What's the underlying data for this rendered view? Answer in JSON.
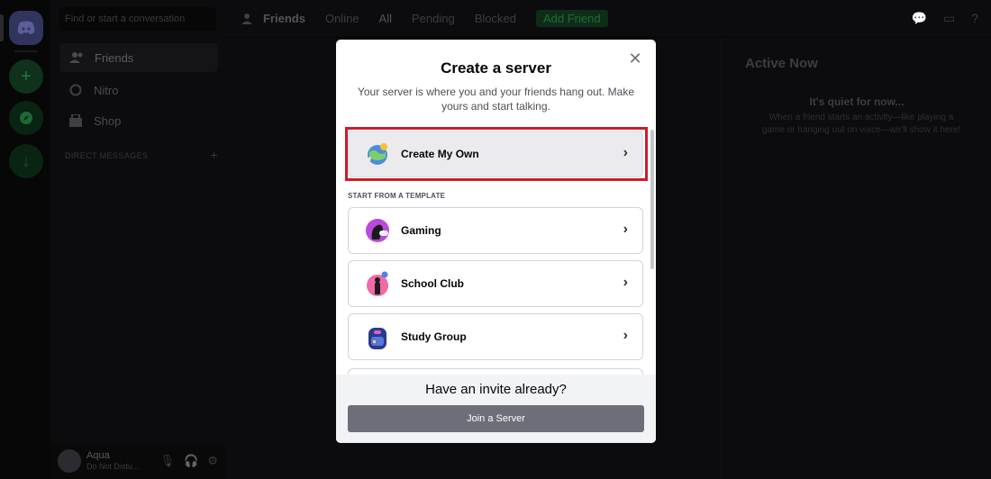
{
  "colors": {
    "accent_red": "#d11a2a",
    "join_button": "#6d6f78",
    "modal_bg": "#ffffff"
  },
  "sidebar": {
    "search_placeholder": "Find or start a conversation",
    "nav": [
      {
        "label": "Friends",
        "icon": "friends-icon"
      },
      {
        "label": "Nitro",
        "icon": "nitro-icon"
      },
      {
        "label": "Shop",
        "icon": "shop-icon"
      }
    ],
    "dm_header": "DIRECT MESSAGES",
    "dm_add": "+",
    "user": {
      "name": "Aqua",
      "status": "Do Not Distu..."
    }
  },
  "topbar": {
    "title": "Friends",
    "tabs": [
      "Online",
      "All",
      "Pending",
      "Blocked"
    ],
    "add_friend": "Add Friend"
  },
  "active_now": {
    "heading": "Active Now",
    "quiet": "It's quiet for now...",
    "description": "When a friend starts an activity—like playing a game or hanging out on voice—we'll show it here!"
  },
  "modal": {
    "title": "Create a server",
    "subtitle": "Your server is where you and your friends hang out. Make yours and start talking.",
    "create_own": "Create My Own",
    "template_header": "START FROM A TEMPLATE",
    "templates": [
      {
        "label": "Gaming",
        "icon": "gaming-icon"
      },
      {
        "label": "School Club",
        "icon": "school-club-icon"
      },
      {
        "label": "Study Group",
        "icon": "study-group-icon"
      }
    ],
    "footer_title": "Have an invite already?",
    "join_label": "Join a Server"
  }
}
